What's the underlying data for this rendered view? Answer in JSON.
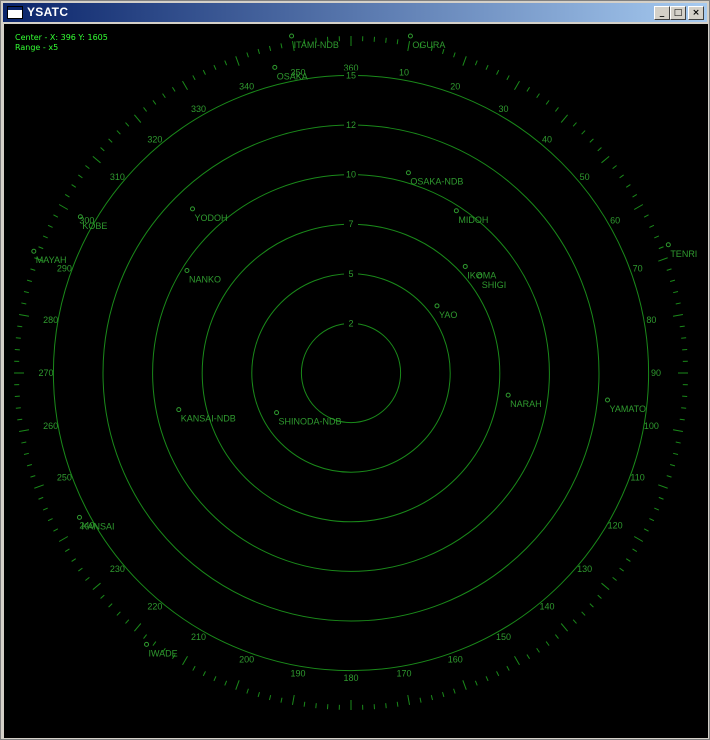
{
  "window": {
    "title": "YSATC",
    "buttons": {
      "minimize": "_",
      "maximize": "□",
      "close": "×"
    }
  },
  "readout": {
    "center": "Center - X: 396  Y: 1605",
    "range": "Range - x5"
  },
  "colors": {
    "background": "#000000",
    "scope_green": "#1a8a1a",
    "label_green": "#2f9a2f",
    "readout_green": "#33ff33"
  },
  "range_rings": [
    {
      "label": "2",
      "radius": 2
    },
    {
      "label": "5",
      "radius": 4
    },
    {
      "label": "7",
      "radius": 6
    },
    {
      "label": "10",
      "radius": 8
    },
    {
      "label": "12",
      "radius": 10
    },
    {
      "label": "15",
      "radius": 12
    }
  ],
  "bearing_labels": [
    "360",
    "10",
    "20",
    "30",
    "40",
    "50",
    "60",
    "70",
    "80",
    "90",
    "100",
    "110",
    "120",
    "130",
    "140",
    "150",
    "160",
    "170",
    "180",
    "190",
    "200",
    "210",
    "220",
    "230",
    "240",
    "250",
    "260",
    "270",
    "280",
    "290",
    "300",
    "310",
    "320",
    "330",
    "340",
    "350"
  ],
  "waypoints": [
    {
      "name": "ITAMI-NDB",
      "bearing": 350,
      "dist": 13.8
    },
    {
      "name": "OGURA",
      "bearing": 10,
      "dist": 13.8
    },
    {
      "name": "OSAKA",
      "bearing": 346,
      "dist": 12.7
    },
    {
      "name": "OSAKA-NDB",
      "bearing": 16,
      "dist": 8.4
    },
    {
      "name": "YODOH",
      "bearing": 316,
      "dist": 9.2
    },
    {
      "name": "MIDOH",
      "bearing": 33,
      "dist": 7.8
    },
    {
      "name": "IKOMA",
      "bearing": 47,
      "dist": 6.3
    },
    {
      "name": "SHIGI",
      "bearing": 53,
      "dist": 6.5
    },
    {
      "name": "KOBE",
      "bearing": 300,
      "dist": 12.6
    },
    {
      "name": "TENRI",
      "bearing": 68,
      "dist": 13.8
    },
    {
      "name": "MAYAH",
      "bearing": 291,
      "dist": 13.7
    },
    {
      "name": "NANKO",
      "bearing": 302,
      "dist": 7.8
    },
    {
      "name": "YAO",
      "bearing": 52,
      "dist": 4.4
    },
    {
      "name": "KANSAI-NDB",
      "bearing": 258,
      "dist": 7.1
    },
    {
      "name": "SHINODA-NDB",
      "bearing": 242,
      "dist": 3.4
    },
    {
      "name": "NARAH",
      "bearing": 98,
      "dist": 6.4
    },
    {
      "name": "YAMATO",
      "bearing": 96,
      "dist": 10.4
    },
    {
      "name": "KANSAI",
      "bearing": 242,
      "dist": 12.4
    },
    {
      "name": "IWADE",
      "bearing": 217,
      "dist": 13.7
    }
  ]
}
